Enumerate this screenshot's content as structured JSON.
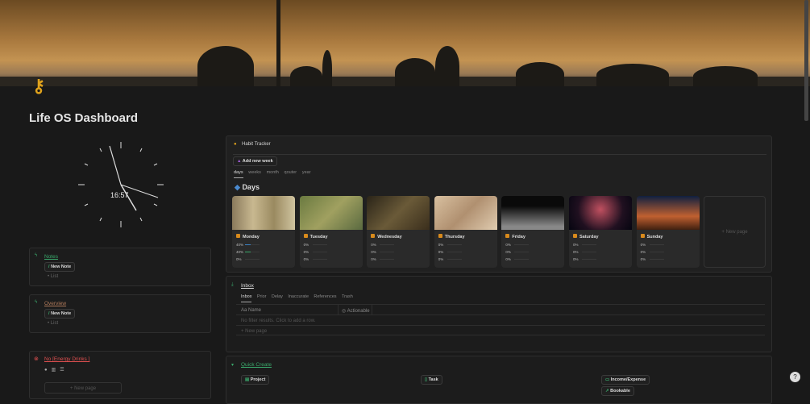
{
  "page": {
    "title": "Life OS Dashboard",
    "icon": "key-icon"
  },
  "clock": {
    "time": "16:57"
  },
  "notes": {
    "title": "Notes",
    "button": "New Note",
    "list": "List"
  },
  "overview": {
    "title": "Overview",
    "button": "New Note",
    "list": "List"
  },
  "habit_block": {
    "title": "No [Energy Drinks ]",
    "new_page": "New page"
  },
  "habit_tracker": {
    "title": "Habit Tracker",
    "add_button": "Add new week",
    "tabs": [
      "days",
      "weeks",
      "month",
      "qouter",
      "year"
    ],
    "heading": "Days",
    "new_page": "New page",
    "days": [
      {
        "name": "Monday",
        "rows": [
          {
            "label": "40%",
            "value": 0.4
          },
          {
            "label": "40%",
            "value": 0.4
          },
          {
            "label": "0%",
            "value": 0
          }
        ]
      },
      {
        "name": "Tuesday",
        "rows": [
          {
            "label": "0%",
            "value": 0
          },
          {
            "label": "0%",
            "value": 0
          },
          {
            "label": "0%",
            "value": 0
          }
        ]
      },
      {
        "name": "Wednesday",
        "rows": [
          {
            "label": "0%",
            "value": 0
          },
          {
            "label": "0%",
            "value": 0
          },
          {
            "label": "0%",
            "value": 0
          }
        ]
      },
      {
        "name": "Thursday",
        "rows": [
          {
            "label": "0%",
            "value": 0
          },
          {
            "label": "0%",
            "value": 0
          },
          {
            "label": "0%",
            "value": 0
          }
        ]
      },
      {
        "name": "Friday",
        "rows": [
          {
            "label": "0%",
            "value": 0
          },
          {
            "label": "0%",
            "value": 0
          },
          {
            "label": "0%",
            "value": 0
          }
        ]
      },
      {
        "name": "Saturday",
        "rows": [
          {
            "label": "0%",
            "value": 0
          },
          {
            "label": "0%",
            "value": 0
          },
          {
            "label": "0%",
            "value": 0
          }
        ]
      },
      {
        "name": "Sunday",
        "rows": [
          {
            "label": "0%",
            "value": 0
          },
          {
            "label": "0%",
            "value": 0
          },
          {
            "label": "0%",
            "value": 0
          }
        ]
      }
    ]
  },
  "inbox": {
    "title": "Inbox",
    "tabs": [
      "Inbox",
      "Prior",
      "Delay",
      "Inaccurate",
      "References",
      "Trash"
    ],
    "columns": [
      "Name",
      "Actionable"
    ],
    "empty": "No filter results. Click to add a row.",
    "new_page": "New page"
  },
  "quick_create": {
    "title": "Quick Create",
    "buttons": [
      "Project",
      "Task",
      "Income/Expense",
      "Bookable"
    ]
  },
  "colors": {
    "accent_green": "#3aa86b",
    "red": "#e05050",
    "orange": "#e0a21c"
  }
}
